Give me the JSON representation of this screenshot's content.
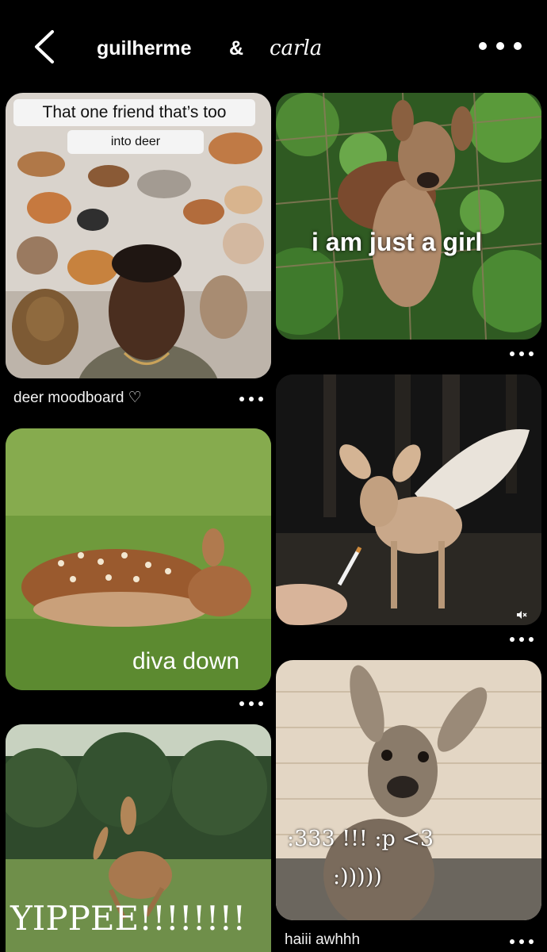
{
  "header": {
    "user1": "guilherme",
    "ampersand": "&",
    "user2": "carla",
    "back_icon": "chevron-left-icon",
    "more_icon": "more-horizontal-icon"
  },
  "pins": [
    {
      "id": "deer-moodboard",
      "caption": "deer moodboard ♡",
      "meme_line1": "That one friend that’s too",
      "meme_line2": "into deer"
    },
    {
      "id": "just-a-girl",
      "overlay": "i am just a girl"
    },
    {
      "id": "diva-down",
      "overlay": "diva down"
    },
    {
      "id": "winged-fawn",
      "mute_icon": "muted-speaker-icon"
    },
    {
      "id": "yippee",
      "overlay": "YIPPEE!!!!!!!!"
    },
    {
      "id": "haiii-awhhh",
      "caption": "haiii awhhh",
      "overlay_line1": ":333 !!! :p <3",
      "overlay_line2": ":)))))"
    }
  ],
  "colors": {
    "background": "#000000",
    "text": "#ffffff"
  }
}
